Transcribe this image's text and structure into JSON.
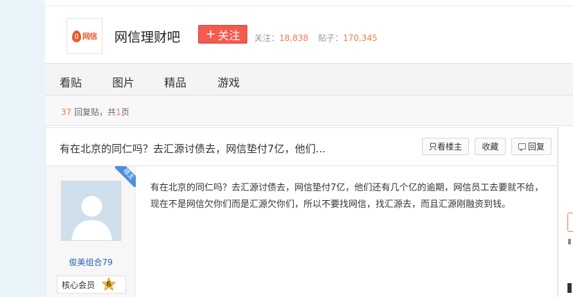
{
  "forum": {
    "name": "网信理财吧",
    "logo_text": "网信",
    "follow_label": "关注",
    "follow_plus": "+",
    "stats": {
      "followers_label": "关注：",
      "followers": "18,838",
      "posts_label": "贴子：",
      "posts": "170,345"
    }
  },
  "nav": {
    "tabs": [
      "看贴",
      "图片",
      "精品",
      "游戏"
    ]
  },
  "reply_bar": {
    "count": "37",
    "count_suffix": " 回复贴，共",
    "pages": "1",
    "pages_suffix": "页"
  },
  "thread": {
    "title": "有在北京的同仁吗？去汇源讨债去，网信垫付7亿，他们...",
    "buttons": {
      "only_op": "只看楼主",
      "favorite": "收藏",
      "reply": "回复"
    }
  },
  "post": {
    "ribbon": "楼主",
    "author": "俊美组合79",
    "rank": "核心会员",
    "level": "6",
    "content": "有在北京的同仁吗？去汇源讨债去，网信垫付7亿，他们还有几个亿的逾期，网信员工去要就不给，现在不是网信欠你们而是汇源欠你们，所以不要找网信，找汇源去，而且汇源刚融资到钱。"
  },
  "colors": {
    "accent_orange": "#f37b4a",
    "follow_red": "#f55a4e",
    "link_blue": "#2d64b3",
    "ribbon_blue": "#4e8fe0"
  }
}
